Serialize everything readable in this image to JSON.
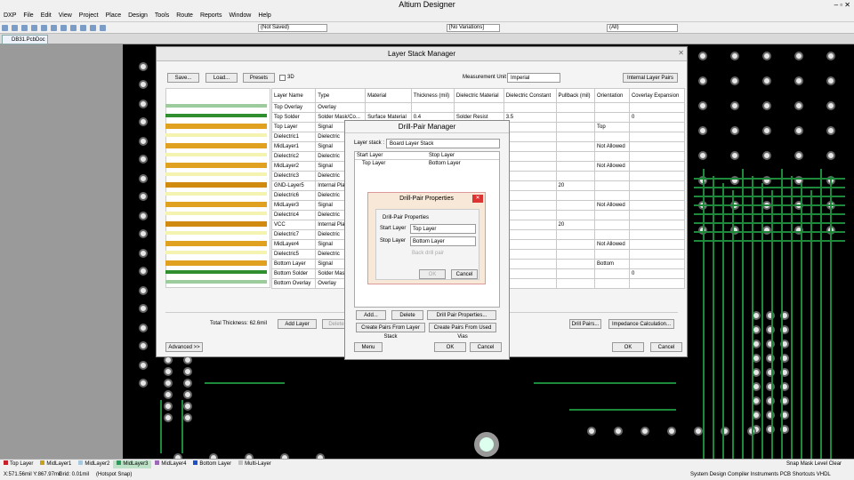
{
  "app": {
    "title": "Altium Designer"
  },
  "menu": [
    "DXP",
    "File",
    "Edit",
    "View",
    "Project",
    "Place",
    "Design",
    "Tools",
    "Route",
    "Reports",
    "Window",
    "Help"
  ],
  "toolbar": {
    "project_combo": "(Not Saved)",
    "variants_combo": "[No Variations]",
    "all_combo": "(All)"
  },
  "doc_tab": "DB31.PcbDoc *",
  "layer_stack_manager": {
    "title": "Layer Stack Manager",
    "save": "Save...",
    "load": "Load...",
    "presets": "Presets",
    "threed": "3D",
    "measurement_unit_label": "Measurement Unit",
    "measurement_unit_value": "Imperial",
    "pairs_combo": "Internal Layer Pairs",
    "columns": [
      "Layer Name",
      "Type",
      "Material",
      "Thickness (mil)",
      "Dielectric Material",
      "Dielectric Constant",
      "Pullback (mil)",
      "Orientation",
      "Coverlay Expansion"
    ],
    "rows": [
      [
        "Top Overlay",
        "Overlay",
        "",
        "",
        "",
        "",
        "",
        "",
        ""
      ],
      [
        "Top Solder",
        "Solder Mask/Co...",
        "Surface Material",
        "0.4",
        "Solder Resist",
        "3.5",
        "",
        "",
        "0"
      ],
      [
        "Top Layer",
        "Signal",
        "",
        "",
        "",
        "",
        "",
        "Top",
        ""
      ],
      [
        "Dielectric1",
        "Dielectric",
        "",
        "",
        "",
        "",
        "",
        "",
        ""
      ],
      [
        "MidLayer1",
        "Signal",
        "",
        "",
        "",
        "",
        "",
        "Not Allowed",
        ""
      ],
      [
        "Dielectric2",
        "Dielectric",
        "",
        "",
        "",
        "",
        "",
        "",
        ""
      ],
      [
        "MidLayer2",
        "Signal",
        "",
        "",
        "",
        "",
        "",
        "Not Allowed",
        ""
      ],
      [
        "Dielectric3",
        "Dielectric",
        "",
        "",
        "",
        "",
        "",
        "",
        ""
      ],
      [
        "GND-Layer5",
        "Internal Pla",
        "",
        "",
        "",
        "",
        "20",
        "",
        ""
      ],
      [
        "Dielectric6",
        "Dielectric",
        "",
        "",
        "",
        "",
        "",
        "",
        ""
      ],
      [
        "MidLayer3",
        "Signal",
        "",
        "",
        "",
        "",
        "",
        "Not Allowed",
        ""
      ],
      [
        "Dielectric4",
        "Dielectric",
        "",
        "",
        "",
        "",
        "",
        "",
        ""
      ],
      [
        "VCC",
        "Internal Pla",
        "",
        "",
        "",
        "",
        "20",
        "",
        ""
      ],
      [
        "Dielectric7",
        "Dielectric",
        "",
        "",
        "",
        "",
        "",
        "",
        ""
      ],
      [
        "MidLayer4",
        "Signal",
        "",
        "",
        "",
        "",
        "",
        "Not Allowed",
        ""
      ],
      [
        "Dielectric5",
        "Dielectric",
        "",
        "",
        "",
        "",
        "",
        "",
        ""
      ],
      [
        "Bottom Layer",
        "Signal",
        "",
        "",
        "",
        "",
        "",
        "Bottom",
        ""
      ],
      [
        "Bottom Solder",
        "Solder Mas",
        "",
        "",
        "",
        "",
        "",
        "",
        "0"
      ],
      [
        "Bottom Overlay",
        "Overlay",
        "",
        "",
        "",
        "",
        "",
        "",
        ""
      ]
    ],
    "total_thickness": "Total Thickness: 62.6mil",
    "add_layer": "Add Layer",
    "delete": "Delete",
    "drill_pairs": "Drill Pairs...",
    "impedance": "Impedance Calculation...",
    "advanced": "Advanced >>",
    "ok": "OK",
    "cancel": "Cancel"
  },
  "drill_pair_manager": {
    "title": "Drill-Pair Manager",
    "layer_stack_label": "Layer stack :",
    "layer_stack_value": "Board Layer Stack",
    "col_start": "Start Layer",
    "col_stop": "Stop Layer",
    "row_start": "Top Layer",
    "row_stop": "Bottom Layer",
    "add": "Add...",
    "delete": "Delete",
    "properties": "Drill Pair Properties...",
    "from_stack": "Create Pairs From Layer Stack",
    "from_vias": "Create Pairs From Used Vias",
    "menu": "Menu",
    "ok": "OK",
    "cancel": "Cancel"
  },
  "drill_pair_properties": {
    "title": "Drill-Pair Properties",
    "group": "Drill-Pair Properties",
    "start_label": "Start Layer",
    "start_value": "Top Layer",
    "stop_label": "Stop Layer",
    "stop_value": "Bottom Layer",
    "back_drill": "Back drill pair",
    "ok": "OK",
    "cancel": "Cancel"
  },
  "layer_tabs": [
    {
      "label": "Top Layer",
      "color": "#c8202a"
    },
    {
      "label": "MidLayer1",
      "color": "#c8a020"
    },
    {
      "label": "MidLayer2",
      "color": "#a8c8e0"
    },
    {
      "label": "MidLayer3",
      "color": "#2a9a5a"
    },
    {
      "label": "MidLayer4",
      "color": "#9a6ab8"
    },
    {
      "label": "Bottom Layer",
      "color": "#2050c8"
    },
    {
      "label": "Multi-Layer",
      "color": "#c0c0c0"
    }
  ],
  "status": {
    "coords": "X:571.56mil Y:867.97mil",
    "grid": "Grid: 0.01mil",
    "snap": "(Hotspot Snap)",
    "right_items": [
      "System",
      "Design Compiler",
      "Instruments",
      "PCB",
      "Shortcuts",
      "VHDL"
    ],
    "snap_items": [
      "Snap",
      "Mask Level",
      "Clear"
    ]
  }
}
